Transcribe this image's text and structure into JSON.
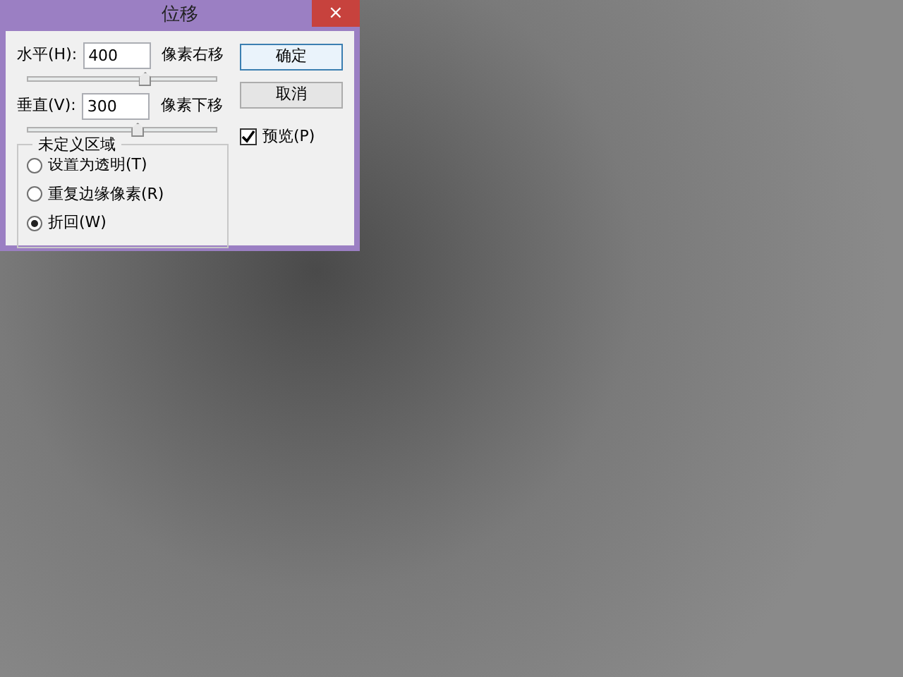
{
  "window": {
    "title": "位移",
    "close": "×"
  },
  "fields": [
    {
      "label": "水平(H):",
      "value": "400",
      "unit": "像素右移",
      "level": 0.62
    },
    {
      "label": "垂直(V):",
      "value": "300",
      "unit": "像素下移",
      "level": 0.58
    }
  ],
  "buttons": [
    {
      "label": "确定",
      "default": true
    },
    {
      "label": "取消",
      "default": false
    }
  ],
  "preview": {
    "label": "预览(P)",
    "checked": true
  },
  "undefined_area": {
    "title": "未定义区域",
    "options": [
      {
        "label": "设置为透明(T)",
        "selected": false
      },
      {
        "label": "重复边缘像素(R)",
        "selected": false
      },
      {
        "label": "折回(W)",
        "selected": true
      }
    ]
  }
}
